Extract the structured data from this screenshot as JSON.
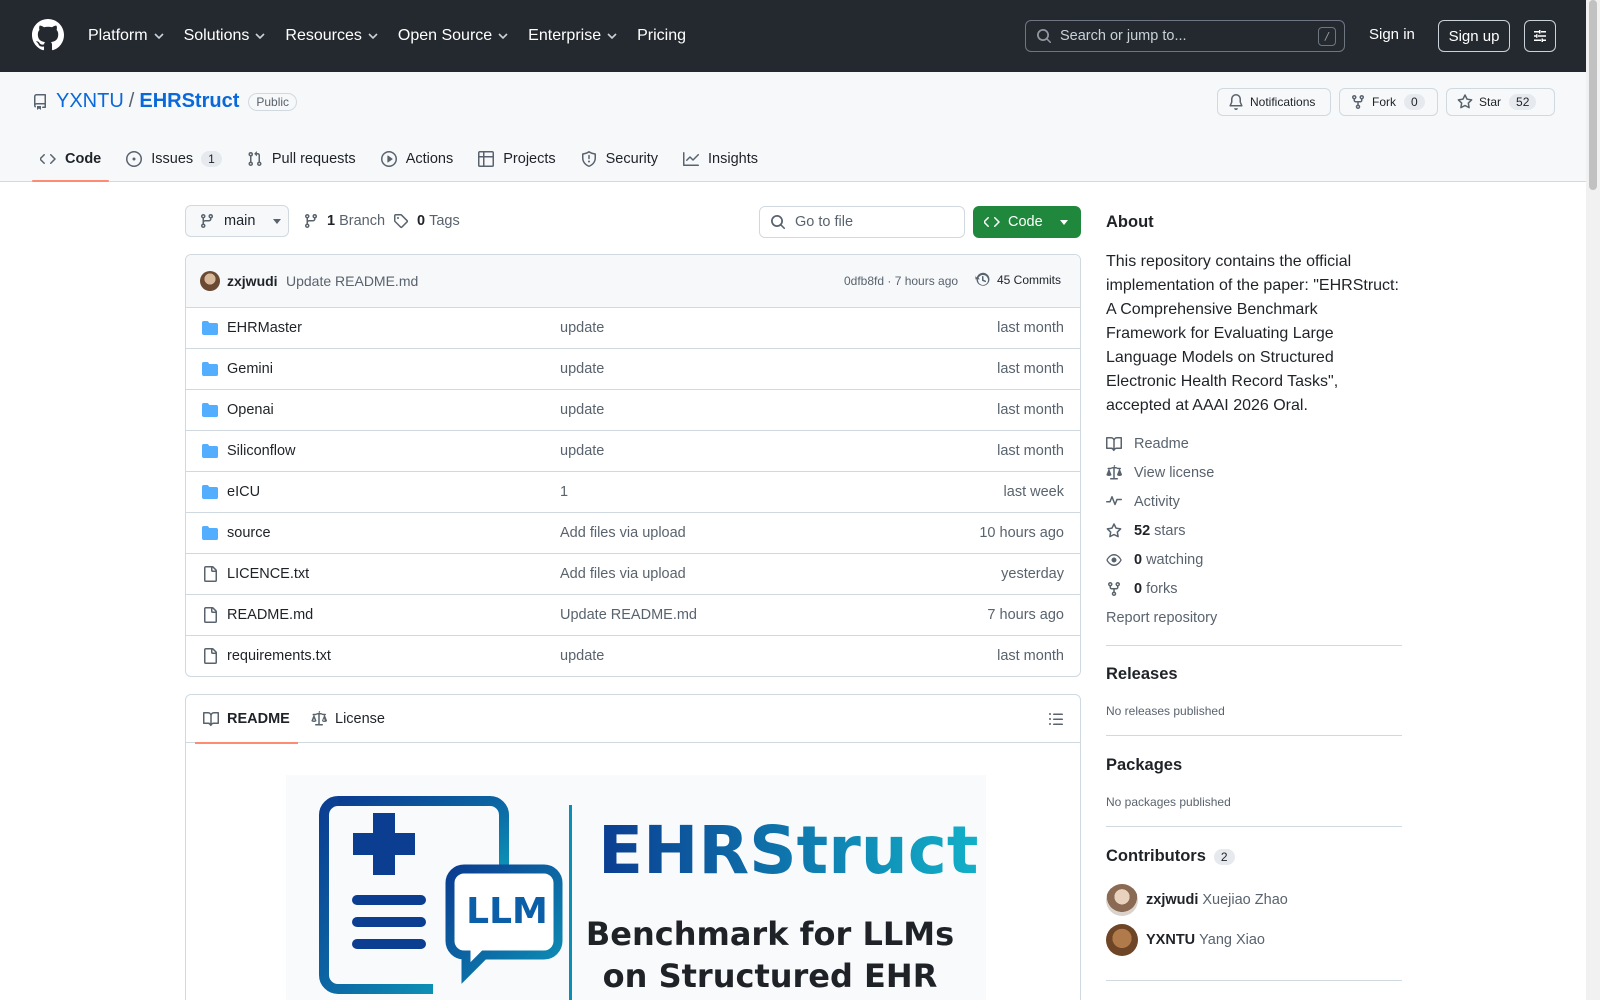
{
  "header": {
    "nav": [
      "Platform",
      "Solutions",
      "Resources",
      "Open Source",
      "Enterprise",
      "Pricing"
    ],
    "search_placeholder": "Search or jump to...",
    "search_shortcut": "/",
    "signin": "Sign in",
    "signup": "Sign up"
  },
  "repo": {
    "owner": "YXNTU",
    "sep": "/",
    "name": "EHRStruct",
    "visibility": "Public",
    "notifications": "Notifications",
    "fork_label": "Fork",
    "fork_count": "0",
    "star_label": "Star",
    "star_count": "52"
  },
  "tabs": [
    {
      "label": "Code",
      "icon": "code-icon"
    },
    {
      "label": "Issues",
      "icon": "issue-icon",
      "count": "1"
    },
    {
      "label": "Pull requests",
      "icon": "pull-request-icon"
    },
    {
      "label": "Actions",
      "icon": "play-icon"
    },
    {
      "label": "Projects",
      "icon": "table-icon"
    },
    {
      "label": "Security",
      "icon": "shield-icon"
    },
    {
      "label": "Insights",
      "icon": "graph-icon"
    }
  ],
  "toolbar": {
    "branch": "main",
    "branches_count": "1",
    "branches_label": "Branch",
    "tags_count": "0",
    "tags_label": "Tags",
    "goto_placeholder": "Go to file",
    "code_button": "Code"
  },
  "commit": {
    "user": "zxjwudi",
    "message": "Update README.md",
    "meta": "0dfb8fd · 7 hours ago",
    "commits": "45 Commits"
  },
  "files": [
    {
      "type": "dir",
      "name": "EHRMaster",
      "msg": "update",
      "age": "last month"
    },
    {
      "type": "dir",
      "name": "Gemini",
      "msg": "update",
      "age": "last month"
    },
    {
      "type": "dir",
      "name": "Openai",
      "msg": "update",
      "age": "last month"
    },
    {
      "type": "dir",
      "name": "Siliconflow",
      "msg": "update",
      "age": "last month"
    },
    {
      "type": "dir",
      "name": "eICU",
      "msg": "1",
      "age": "last week"
    },
    {
      "type": "dir",
      "name": "source",
      "msg": "Add files via upload",
      "age": "10 hours ago"
    },
    {
      "type": "file",
      "name": "LICENCE.txt",
      "msg": "Add files via upload",
      "age": "yesterday"
    },
    {
      "type": "file",
      "name": "README.md",
      "msg": "Update README.md",
      "age": "7 hours ago"
    },
    {
      "type": "file",
      "name": "requirements.txt",
      "msg": "update",
      "age": "last month"
    }
  ],
  "readme": {
    "tab_readme": "README",
    "tab_license": "License",
    "banner_title": "EHRStruct",
    "banner_badge": "LLM",
    "banner_line1": "Benchmark for LLMs",
    "banner_line2": "on Structured EHR"
  },
  "about": {
    "heading": "About",
    "description": "This repository contains the official implementation of the paper: \"EHRStruct: A Comprehensive Benchmark Framework for Evaluating Large Language Models on Structured Electronic Health Record Tasks\", accepted at AAAI 2026 Oral.",
    "readme": "Readme",
    "license": "View license",
    "activity": "Activity",
    "stars_count": "52",
    "stars_label": "stars",
    "watching_count": "0",
    "watching_label": "watching",
    "forks_count": "0",
    "forks_label": "forks",
    "report": "Report repository"
  },
  "releases": {
    "heading": "Releases",
    "note": "No releases published"
  },
  "packages": {
    "heading": "Packages",
    "note": "No packages published"
  },
  "contributors": {
    "heading": "Contributors",
    "count": "2",
    "people": [
      {
        "login": "zxjwudi",
        "name": "Xuejiao Zhao"
      },
      {
        "login": "YXNTU",
        "name": "Yang Xiao"
      }
    ]
  },
  "colors": {
    "accent": "#0969da",
    "green": "#1f883d",
    "header_bg": "#24292f",
    "tab_underline": "#fd8c73"
  }
}
